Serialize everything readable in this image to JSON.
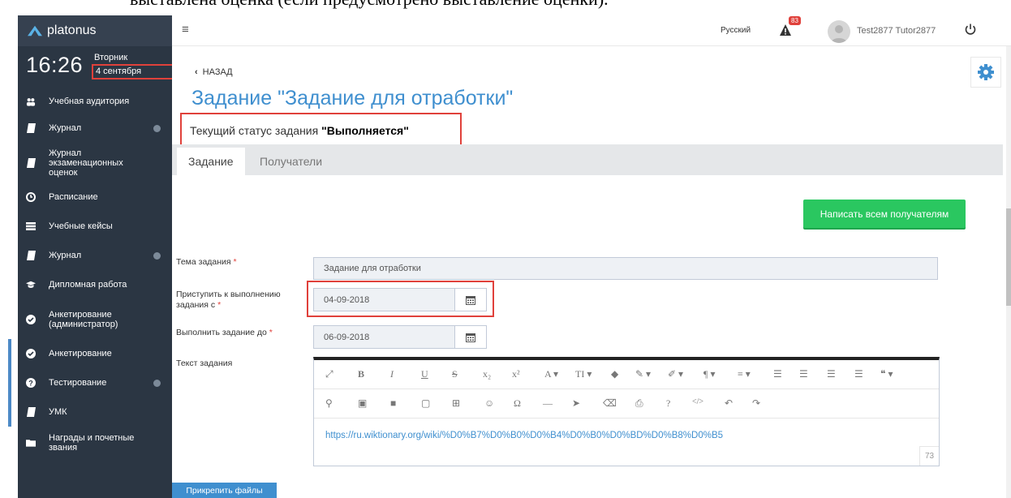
{
  "doc_caption": "выставлена оценка (если предусмотрено выставление оценки).",
  "sidebar": {
    "logo": "platonus",
    "clock": {
      "time": "16:26",
      "day": "Вторник",
      "date": "4 сентября"
    },
    "items": [
      {
        "label": "Учебная аудитория",
        "icon": "group-icon",
        "has_arrow": false
      },
      {
        "label": "Журнал",
        "icon": "book-icon",
        "has_arrow": true
      },
      {
        "label": "Журнал экзаменационных оценок",
        "icon": "book-icon",
        "has_arrow": false
      },
      {
        "label": "Расписание",
        "icon": "clock-icon",
        "has_arrow": false
      },
      {
        "label": "Учебные кейсы",
        "icon": "list-icon",
        "has_arrow": false
      },
      {
        "label": "Журнал",
        "icon": "book-icon",
        "has_arrow": true
      },
      {
        "label": "Дипломная работа",
        "icon": "graduation-cap-icon",
        "has_arrow": false
      },
      {
        "label": "Анкетирование (администратор)",
        "icon": "check-circle-icon",
        "has_arrow": false
      },
      {
        "label": "Анкетирование",
        "icon": "check-circle-icon",
        "has_arrow": false
      },
      {
        "label": "Тестирование",
        "icon": "question-circle-icon",
        "has_arrow": true
      },
      {
        "label": "УМК",
        "icon": "book-icon",
        "has_arrow": false
      },
      {
        "label": "Награды и почетные звания",
        "icon": "folder-icon",
        "has_arrow": false
      }
    ]
  },
  "topbar": {
    "language": "Русский",
    "notifications_count": "83",
    "user_name": "Test2877 Tutor2877"
  },
  "main": {
    "back_label": "НАЗАД",
    "title": "Задание \"Задание для отработки\"",
    "status_prefix": "Текущий статус задания ",
    "status_value": "\"Выполняется\"",
    "tabs": [
      {
        "label": "Задание"
      },
      {
        "label": "Получатели"
      }
    ],
    "write_all_label": "Написать всем получателям",
    "form": {
      "topic_label": "Тема задания",
      "topic_value": "Задание для отработки",
      "start_label": "Приступить к выполнению задания с",
      "start_value": "04-09-2018",
      "due_label": "Выполнить задание до",
      "due_value": "06-09-2018",
      "text_label": "Текст задания",
      "text_value": "https://ru.wiktionary.org/wiki/%D0%B7%D0%B0%D0%B4%D0%B0%D0%BD%D0%B8%D0%B5",
      "char_count": "73",
      "required_mark": "*"
    },
    "attach_label": "Прикрепить файлы"
  },
  "editor_toolbar": {
    "row1": [
      "⤢",
      "B",
      "I",
      "U",
      "S",
      "x₂",
      "x²",
      "A ▾",
      "TI ▾",
      "◆",
      "✎ ▾",
      "✐ ▾",
      "¶ ▾",
      "≡ ▾",
      "☰",
      "☰",
      "☰",
      "☰",
      "❝ ▾"
    ],
    "row2": [
      "⚲",
      "▣",
      "■",
      "▢",
      "⊞",
      "☺",
      "Ω",
      "—",
      "➤",
      "⌫",
      "⎙",
      "?",
      "</>",
      "↶",
      "↷"
    ]
  }
}
